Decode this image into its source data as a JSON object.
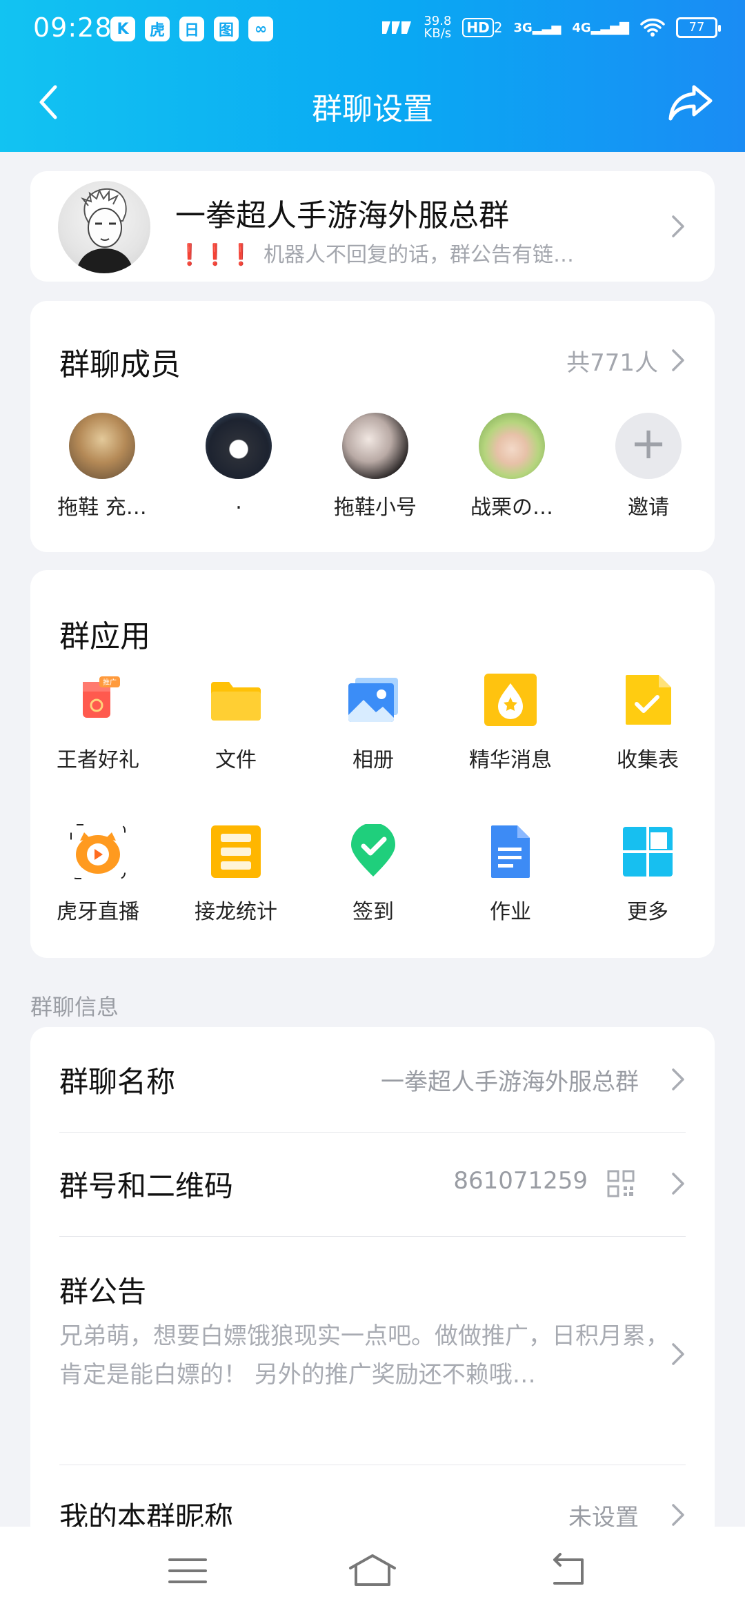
{
  "status_bar": {
    "time": "09:28",
    "left_icons": [
      "K",
      "虎",
      "日",
      "图",
      "∞"
    ],
    "net_speed_value": "39.8",
    "net_speed_unit": "KB/s",
    "hd": "HD",
    "hd_sub": "2",
    "sig_3g": "3G",
    "sig_4g": "4G",
    "battery": "77"
  },
  "header": {
    "title": "群聊设置"
  },
  "group": {
    "name": "一拳超人手游海外服总群",
    "notice_bangs": "❗❗❗",
    "notice_preview": "机器人不回复的话，群公告有链…"
  },
  "members": {
    "title": "群聊成员",
    "count": "共771人",
    "list": [
      {
        "name": "拖鞋 充…"
      },
      {
        "name": "."
      },
      {
        "name": "拖鞋小号"
      },
      {
        "name": "战栗の…"
      }
    ],
    "invite_label": "邀请"
  },
  "apps": {
    "title": "群应用",
    "items": [
      {
        "label": "王者好礼",
        "icon": "gift-icon"
      },
      {
        "label": "文件",
        "icon": "folder-icon"
      },
      {
        "label": "相册",
        "icon": "photo-album-icon"
      },
      {
        "label": "精华消息",
        "icon": "essence-icon"
      },
      {
        "label": "收集表",
        "icon": "form-icon"
      },
      {
        "label": "虎牙直播",
        "icon": "huya-icon"
      },
      {
        "label": "接龙统计",
        "icon": "relay-icon"
      },
      {
        "label": "签到",
        "icon": "checkin-icon"
      },
      {
        "label": "作业",
        "icon": "homework-icon"
      },
      {
        "label": "更多",
        "icon": "more-apps-icon"
      }
    ],
    "gift_badge": "推广"
  },
  "info": {
    "section_title": "群聊信息",
    "group_name_label": "群聊名称",
    "group_name_value": "一拳超人手游海外服总群",
    "group_id_label": "群号和二维码",
    "group_id_value": "861071259",
    "notice_label": "群公告",
    "notice_text": "兄弟萌，想要白嫖饿狼现实一点吧。做做推广，日积月累，肯定是能白嫖的！ 另外的推广奖励还不赖哦…",
    "nickname_label": "我的本群昵称",
    "nickname_value": "未设置"
  },
  "colors": {
    "header_start": "#12c3f2",
    "header_end": "#1a8cf4",
    "page_bg": "#f2f3f7",
    "secondary_text": "#a3a6ad",
    "alert": "#e02323"
  }
}
